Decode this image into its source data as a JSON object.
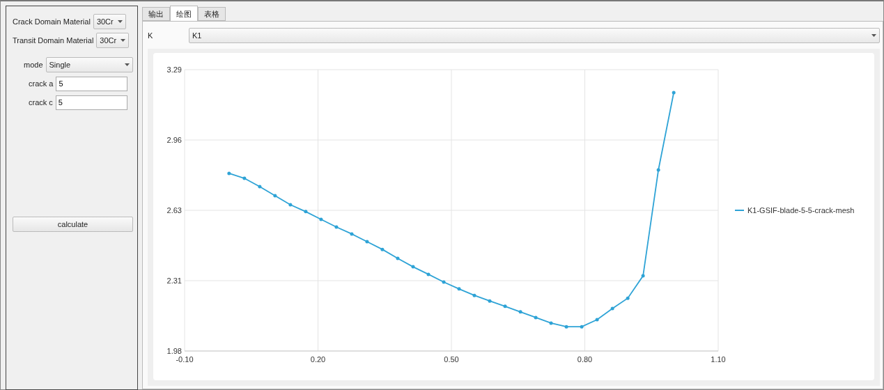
{
  "left_panel": {
    "fields": [
      {
        "kind": "compact",
        "label": "Crack Domain Material",
        "value": "30Cr"
      },
      {
        "kind": "compact",
        "label": "Transit Domain Material",
        "value": "30Cr"
      },
      {
        "kind": "wide",
        "label": "mode",
        "value": "Single"
      },
      {
        "kind": "input",
        "label": "crack a",
        "value": "5"
      },
      {
        "kind": "input",
        "label": "crack c",
        "value": "5"
      }
    ],
    "button": "calculate"
  },
  "tabs": [
    {
      "label": "输出",
      "selected": false
    },
    {
      "label": "绘图",
      "selected": true
    },
    {
      "label": "表格",
      "selected": false
    }
  ],
  "selector": {
    "label": "K",
    "value": "K1"
  },
  "chart": {
    "chart_data": {
      "type": "line",
      "grid": true,
      "x": [
        0,
        0.0345,
        0.069,
        0.1034,
        0.1379,
        0.1724,
        0.2069,
        0.2414,
        0.2759,
        0.3103,
        0.3448,
        0.3793,
        0.4138,
        0.4483,
        0.4828,
        0.5172,
        0.5517,
        0.5862,
        0.6207,
        0.6552,
        0.6897,
        0.7241,
        0.7586,
        0.7931,
        0.8276,
        0.8621,
        0.8966,
        0.931,
        0.9655,
        1.0
      ],
      "series": [
        {
          "name": "K1-GSIF-blade-5-5-crack-mesh",
          "color": "#2ea3d6",
          "values": [
            2.807,
            2.784,
            2.745,
            2.703,
            2.661,
            2.629,
            2.593,
            2.557,
            2.525,
            2.489,
            2.453,
            2.411,
            2.372,
            2.337,
            2.301,
            2.269,
            2.239,
            2.213,
            2.188,
            2.162,
            2.136,
            2.11,
            2.093,
            2.093,
            2.126,
            2.178,
            2.226,
            2.33,
            2.823,
            3.183
          ]
        }
      ],
      "xlim": [
        -0.1,
        1.1
      ],
      "ylim": [
        1.98,
        3.29
      ],
      "xticks": [
        {
          "value": -0.1,
          "label": "-0.10"
        },
        {
          "value": 0.2,
          "label": "0.20"
        },
        {
          "value": 0.5,
          "label": "0.50"
        },
        {
          "value": 0.8,
          "label": "0.80"
        },
        {
          "value": 1.1,
          "label": "1.10"
        }
      ],
      "yticks": [
        {
          "value": 1.98,
          "label": "1.98"
        },
        {
          "value": 2.3075,
          "label": "2.31"
        },
        {
          "value": 2.635,
          "label": "2.63"
        },
        {
          "value": 2.9625,
          "label": "2.96"
        },
        {
          "value": 3.29,
          "label": "3.29"
        }
      ]
    }
  }
}
